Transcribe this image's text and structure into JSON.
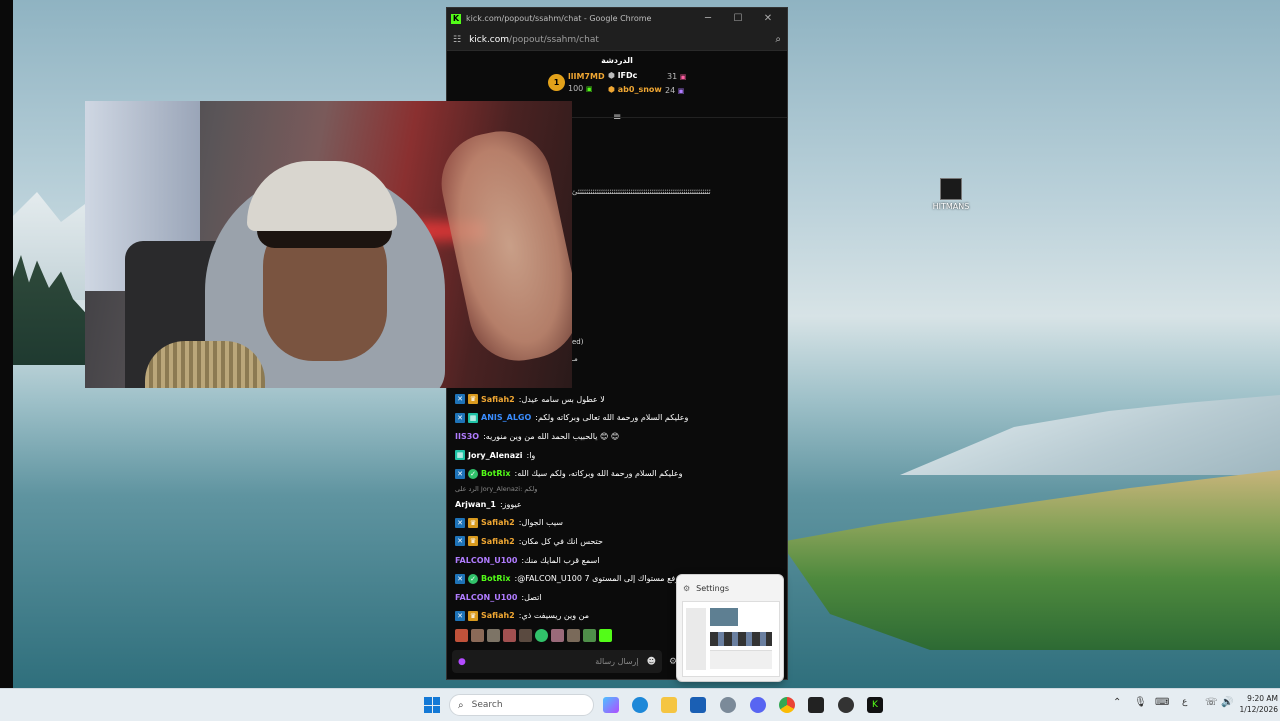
{
  "desktop": {
    "icon_label": "HITMANS"
  },
  "window": {
    "title": "kick.com/popout/ssahm/chat - Google Chrome",
    "url_host": "kick.com",
    "url_path": "/popout/ssahm/chat",
    "controls": {
      "minimize": "─",
      "maximize": "☐",
      "close": "✕"
    }
  },
  "chat": {
    "header": "الدردشة",
    "leaderboard": [
      {
        "name": "llIM7MD",
        "count": "100",
        "rank": "1"
      },
      {
        "name": "lFDc",
        "count": "31"
      },
      {
        "name": "ab0_snow",
        "count": "24"
      }
    ],
    "spam_line": "ئئئئئئئئئئئئئئئئئئئئئئئئئئئئئئئئئئئئئئئئئئئئئئئئئئئئئئئئئئئئئئئئ",
    "partial_1": "ed)",
    "partial_2": "مـ",
    "messages": [
      {
        "user": "Safiah2",
        "text": "لا عطول بس سامه عيدل",
        "color": "#f0a733",
        "badges": [
          "mod",
          "crown"
        ]
      },
      {
        "user": "ANIS_ALGO",
        "text": "وعليكم السلام ورحمة الله تعالى وبركاته ولكم",
        "color": "#3a8dff",
        "badges": [
          "mod",
          "bot"
        ]
      },
      {
        "user": "IIS3O",
        "text": "يالحبيب الحمد الله من وين منوريه 😊 😊",
        "color": "#b07cff",
        "badges": []
      },
      {
        "user": "Jory_Alenazi",
        "text": "وا",
        "color": "#ffffff",
        "badges": [
          "bot"
        ]
      },
      {
        "user": "BotRix",
        "text": "وعليكم السلام ورحمة الله وبركاته، ولكم سيك الله",
        "color": "#53fc18",
        "badges": [
          "mod",
          "green"
        ]
      },
      {
        "user": "Arjwan_1",
        "text": "عيووز",
        "color": "#ffffff",
        "badges": [],
        "reply": "الرد على Jory_Alenazi: ولكم"
      },
      {
        "user": "Safiah2",
        "text": "سيب الجوال",
        "color": "#f0a733",
        "badges": [
          "mod",
          "crown"
        ]
      },
      {
        "user": "Safiah2",
        "text": "حتحس انك في كل مكان",
        "color": "#f0a733",
        "badges": [
          "mod",
          "crown"
        ]
      },
      {
        "user": "FALCON_U100",
        "text": "اسمع قرب المايك منك",
        "color": "#b07cff",
        "badges": []
      },
      {
        "user": "BotRix",
        "text": "@FALCON_U100 7 لقد رفع مستواك إلى المستوى",
        "color": "#53fc18",
        "badges": [
          "mod",
          "green"
        ]
      },
      {
        "user": "FALCON_U100",
        "text": "اتصل",
        "color": "#b07cff",
        "badges": []
      },
      {
        "user": "Safiah2",
        "text": "من وين ريسيفت ذي",
        "color": "#f0a733",
        "badges": [
          "mod",
          "crown"
        ]
      }
    ],
    "input_placeholder": "إرسال رسالة"
  },
  "settings_preview": {
    "title": "Settings"
  },
  "taskbar": {
    "search_placeholder": "Search",
    "time": "9:20 AM",
    "date": "1/12/2026",
    "lang": "ع"
  },
  "colors": {
    "kick_green": "#53fc18",
    "mod_badge": "#1e73b8",
    "crown_badge": "#d99a1e",
    "chat_bg": "#0b0b0b"
  }
}
